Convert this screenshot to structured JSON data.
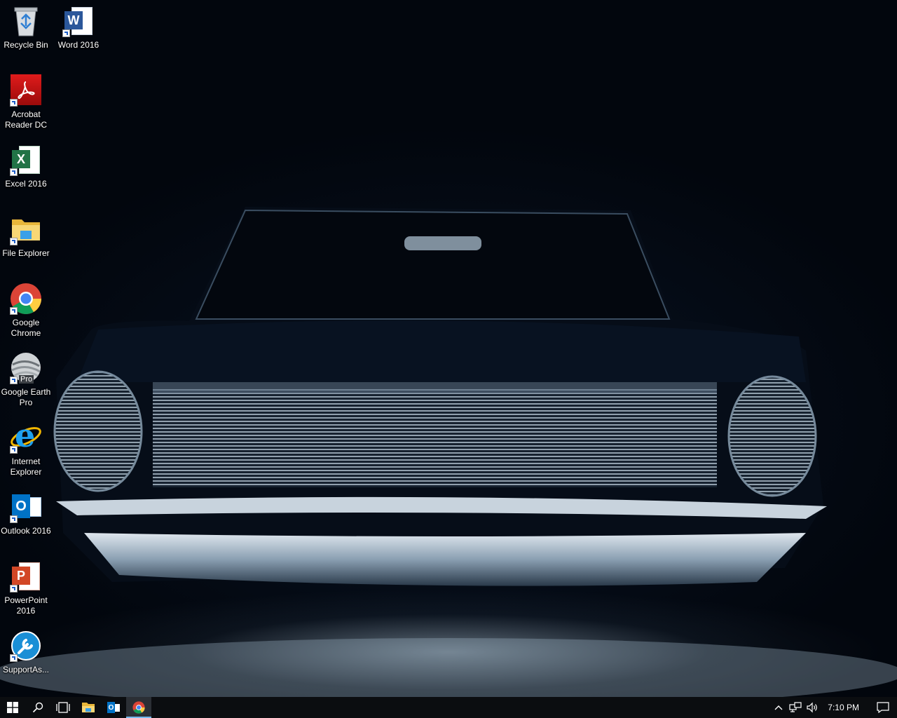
{
  "desktop": {
    "icons": [
      {
        "label": "Recycle Bin",
        "icon": "recycle-bin-icon"
      },
      {
        "label": "Word 2016",
        "icon": "word-icon",
        "glyph": "W"
      },
      {
        "label": "Acrobat Reader DC",
        "icon": "acrobat-icon"
      },
      {
        "label": "Excel 2016",
        "icon": "excel-icon",
        "glyph": "X"
      },
      {
        "label": "File Explorer",
        "icon": "file-explorer-icon"
      },
      {
        "label": "Google Chrome",
        "icon": "chrome-icon"
      },
      {
        "label": "Google Earth Pro",
        "icon": "google-earth-icon",
        "badge": "Pro"
      },
      {
        "label": "Internet Explorer",
        "icon": "internet-explorer-icon",
        "glyph": "e"
      },
      {
        "label": "Outlook 2016",
        "icon": "outlook-icon",
        "glyph": "O"
      },
      {
        "label": "PowerPoint 2016",
        "icon": "powerpoint-icon",
        "glyph": "P"
      },
      {
        "label": "SupportAs...",
        "icon": "supportassist-icon"
      }
    ]
  },
  "taskbar": {
    "buttons": [
      "start-icon",
      "search-icon",
      "task-view-icon",
      "file-explorer-icon",
      "outlook-icon",
      "chrome-icon"
    ],
    "outlook_glyph": "O",
    "active": "chrome-icon",
    "clock": "7:10 PM"
  },
  "colors": {
    "taskbar": "#0b0d10",
    "accent": "#76b9ed",
    "word": "#2b579a",
    "excel": "#217346",
    "outlook": "#0072c6",
    "powerpoint": "#d24726",
    "acrobat": "#c4120f"
  }
}
